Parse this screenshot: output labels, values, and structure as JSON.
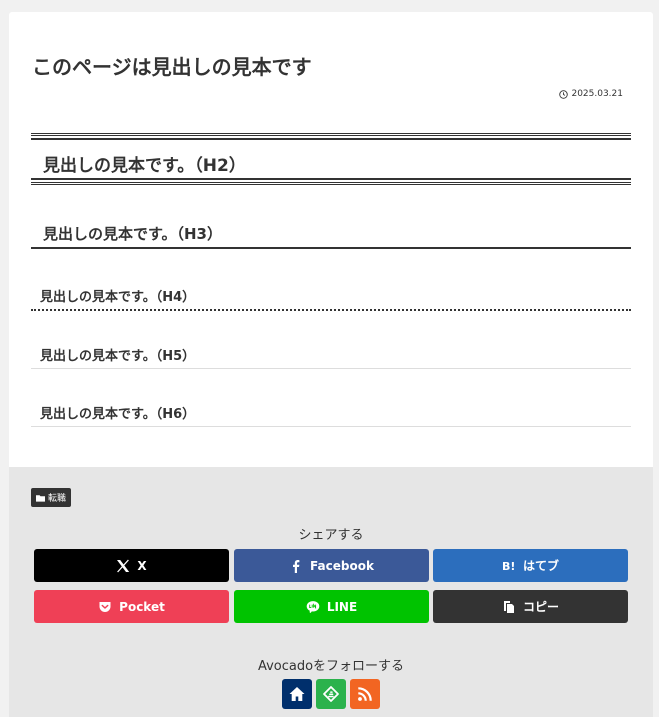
{
  "article": {
    "title": "このページは見出しの見本です",
    "date": "2025.03.21",
    "headings": {
      "h2": "見出しの見本です。（H2）",
      "h3": "見出しの見本です。（H3）",
      "h4": "見出しの見本です。（H4）",
      "h5": "見出しの見本です。（H5）",
      "h6": "見出しの見本です。（H6）"
    }
  },
  "category": {
    "label": "転職"
  },
  "share": {
    "label": "シェアする",
    "buttons": {
      "x": "X",
      "facebook": "Facebook",
      "hatena": "はてブ",
      "pocket": "Pocket",
      "line": "LINE",
      "copy": "コピー"
    }
  },
  "follow": {
    "label": "Avocadoをフォローする",
    "icons": [
      "home-icon",
      "feedly-icon",
      "rss-icon"
    ]
  },
  "colors": {
    "x": "#000000",
    "facebook": "#3b5998",
    "hatena": "#2c6ebd",
    "pocket": "#ef4056",
    "line": "#00c300",
    "copy": "#333333",
    "home": "#002f6c",
    "feedly": "#2bb24c",
    "rss": "#f26522"
  }
}
